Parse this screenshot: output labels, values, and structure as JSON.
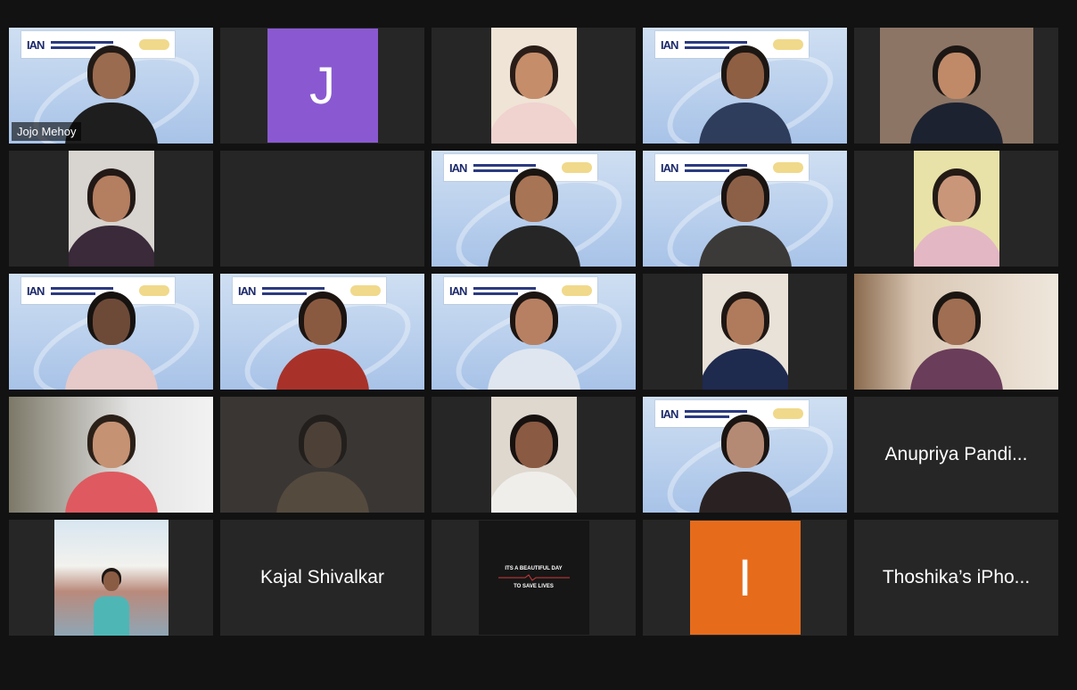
{
  "meeting": {
    "active_speaker": "Jojo Mehoy"
  },
  "tiles": {
    "t1": {
      "name": "Jojo Mehoy"
    },
    "t2": {
      "avatar_letter": "J",
      "avatar_color": "#8a59d1"
    },
    "t19": {
      "name": "Anupriya Pandi..."
    },
    "t22": {
      "name": "Kajal Shivalkar"
    },
    "t23": {
      "line1": "ITS A BEAUTIFUL DAY",
      "line2": "TO SAVE LIVES"
    },
    "t24": {
      "avatar_letter": "I",
      "avatar_color": "#e66c1c"
    },
    "t25": {
      "name": "Thoshika’s iPho..."
    }
  },
  "conference_banner": {
    "logo_text": "IAN",
    "background": "#cfdff2"
  },
  "colors": {
    "window_bg": "#121212",
    "tile_bg": "#262626",
    "active_outline": "#d6e06a"
  }
}
